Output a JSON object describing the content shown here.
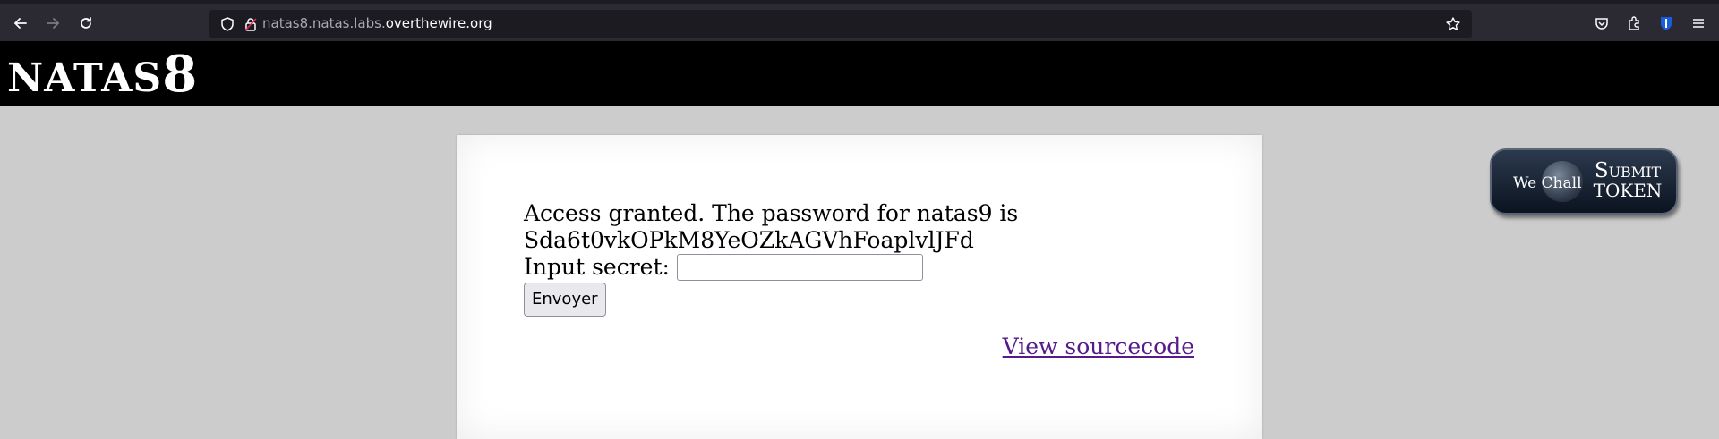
{
  "browser": {
    "url_prefix": "natas8.natas.labs.",
    "url_domain": "overthewire.org"
  },
  "header": {
    "title_word": "NATAS",
    "title_num": "8"
  },
  "main": {
    "access_line1": "Access granted. The password for natas9 is",
    "password": "Sda6t0vkOPkM8YeOZkAGVhFoaplvlJFd",
    "input_label": "Input secret:",
    "input_value": "",
    "submit_label": "Envoyer",
    "view_source_link": "View sourcecode"
  },
  "wechall": {
    "we_label": "We Chall",
    "submit_line1": "Submit",
    "submit_line2": "TOKEN"
  },
  "icons": [
    "back-arrow-icon",
    "forward-arrow-icon",
    "reload-icon",
    "shield-icon",
    "lock-icon",
    "star-icon",
    "pocket-icon",
    "extensions-icon",
    "bitwarden-icon",
    "menu-icon"
  ]
}
